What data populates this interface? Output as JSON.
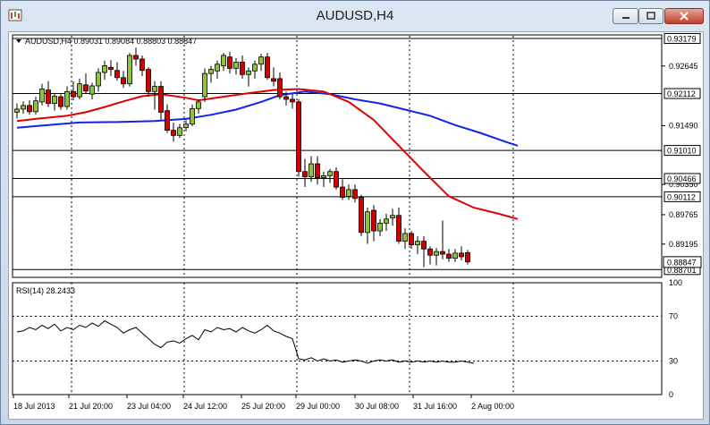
{
  "window": {
    "title": "AUDUSD,H4"
  },
  "chart_data": {
    "type": "candlestick",
    "symbol_info": "AUDUSD,H4  0.89031 0.89084 0.88803 0.88847",
    "ylim": [
      0.8855,
      0.933
    ],
    "price_ticks": [
      "0.92645",
      "0.91490",
      "0.90350",
      "0.89765",
      "0.89195"
    ],
    "hlines": [
      {
        "value": 0.93179,
        "label": "0.93179"
      },
      {
        "value": 0.92112,
        "label": "0.92112"
      },
      {
        "value": 0.9101,
        "label": "0.91010"
      },
      {
        "value": 0.90466,
        "label": "0.90466"
      },
      {
        "value": 0.90112,
        "label": "0.90112"
      },
      {
        "value": 0.88701,
        "label": "0.88701"
      }
    ],
    "current_price": {
      "value": 0.88847,
      "label": "0.88847"
    },
    "time_labels": [
      "18 Jul 2013",
      "21 Jul 20:00",
      "23 Jul 04:00",
      "24 Jul 12:00",
      "25 Jul 20:00",
      "29 Jul 00:00",
      "30 Jul 08:00",
      "31 Jul 16:00",
      "2 Aug 00:00"
    ],
    "candles": [
      [
        0.9175,
        0.9192,
        0.9163,
        0.9181
      ],
      [
        0.9181,
        0.9196,
        0.9172,
        0.9188
      ],
      [
        0.9188,
        0.9198,
        0.917,
        0.9176
      ],
      [
        0.9176,
        0.9205,
        0.917,
        0.9197
      ],
      [
        0.9195,
        0.923,
        0.9188,
        0.922
      ],
      [
        0.9218,
        0.9235,
        0.9185,
        0.9192
      ],
      [
        0.9192,
        0.9212,
        0.9178,
        0.9206
      ],
      [
        0.9205,
        0.921,
        0.918,
        0.9186
      ],
      [
        0.9186,
        0.9225,
        0.918,
        0.9215
      ],
      [
        0.9215,
        0.9235,
        0.9198,
        0.9205
      ],
      [
        0.9205,
        0.924,
        0.92,
        0.923
      ],
      [
        0.9228,
        0.925,
        0.921,
        0.9216
      ],
      [
        0.921,
        0.9232,
        0.92,
        0.9226
      ],
      [
        0.9226,
        0.926,
        0.9215,
        0.9252
      ],
      [
        0.9252,
        0.9275,
        0.9238,
        0.9265
      ],
      [
        0.9262,
        0.9276,
        0.9245,
        0.9258
      ],
      [
        0.9256,
        0.9272,
        0.9236,
        0.9242
      ],
      [
        0.9242,
        0.9255,
        0.9222,
        0.923
      ],
      [
        0.923,
        0.929,
        0.9225,
        0.9285
      ],
      [
        0.9285,
        0.93,
        0.9265,
        0.9278
      ],
      [
        0.9278,
        0.9285,
        0.9245,
        0.9256
      ],
      [
        0.9258,
        0.9262,
        0.9205,
        0.9215
      ],
      [
        0.9215,
        0.9235,
        0.918,
        0.9225
      ],
      [
        0.9225,
        0.9235,
        0.916,
        0.9175
      ],
      [
        0.9178,
        0.919,
        0.9135,
        0.914
      ],
      [
        0.914,
        0.9155,
        0.9118,
        0.913
      ],
      [
        0.913,
        0.9152,
        0.9125,
        0.9145
      ],
      [
        0.9145,
        0.916,
        0.9138,
        0.9152
      ],
      [
        0.9152,
        0.919,
        0.9148,
        0.9182
      ],
      [
        0.9182,
        0.92,
        0.9172,
        0.9195
      ],
      [
        0.9205,
        0.926,
        0.9195,
        0.925
      ],
      [
        0.925,
        0.9265,
        0.9232,
        0.9258
      ],
      [
        0.9255,
        0.9275,
        0.924,
        0.9268
      ],
      [
        0.9265,
        0.929,
        0.9255,
        0.9285
      ],
      [
        0.9282,
        0.9292,
        0.925,
        0.926
      ],
      [
        0.926,
        0.928,
        0.9248,
        0.9272
      ],
      [
        0.9272,
        0.9285,
        0.924,
        0.9248
      ],
      [
        0.9248,
        0.9262,
        0.9225,
        0.9255
      ],
      [
        0.9255,
        0.9275,
        0.924,
        0.9268
      ],
      [
        0.9268,
        0.9288,
        0.9255,
        0.9282
      ],
      [
        0.9282,
        0.929,
        0.9238,
        0.9242
      ],
      [
        0.924,
        0.9262,
        0.9225,
        0.9235
      ],
      [
        0.924,
        0.9252,
        0.92,
        0.9205
      ],
      [
        0.9205,
        0.9215,
        0.9188,
        0.92
      ],
      [
        0.92,
        0.921,
        0.9182,
        0.9195
      ],
      [
        0.9195,
        0.92,
        0.905,
        0.906
      ],
      [
        0.906,
        0.9085,
        0.903,
        0.905
      ],
      [
        0.905,
        0.909,
        0.904,
        0.9075
      ],
      [
        0.9075,
        0.909,
        0.9035,
        0.9048
      ],
      [
        0.9048,
        0.906,
        0.903,
        0.9052
      ],
      [
        0.9052,
        0.9065,
        0.9038,
        0.906
      ],
      [
        0.906,
        0.9068,
        0.9025,
        0.903
      ],
      [
        0.903,
        0.9045,
        0.9005,
        0.901
      ],
      [
        0.9012,
        0.9035,
        0.9005,
        0.9025
      ],
      [
        0.9025,
        0.9035,
        0.9,
        0.9008
      ],
      [
        0.901,
        0.9015,
        0.8935,
        0.8942
      ],
      [
        0.8942,
        0.899,
        0.892,
        0.8982
      ],
      [
        0.8985,
        0.8995,
        0.8925,
        0.8945
      ],
      [
        0.8945,
        0.8968,
        0.8935,
        0.896
      ],
      [
        0.896,
        0.8978,
        0.8945,
        0.8968
      ],
      [
        0.897,
        0.8988,
        0.8955,
        0.8975
      ],
      [
        0.8975,
        0.899,
        0.892,
        0.8925
      ],
      [
        0.8925,
        0.895,
        0.891,
        0.894
      ],
      [
        0.894,
        0.8945,
        0.891,
        0.8918
      ],
      [
        0.8918,
        0.8935,
        0.89,
        0.8925
      ],
      [
        0.8925,
        0.8935,
        0.8875,
        0.891
      ],
      [
        0.891,
        0.8915,
        0.888,
        0.8898
      ],
      [
        0.8898,
        0.8912,
        0.8878,
        0.8905
      ],
      [
        0.8905,
        0.8965,
        0.889,
        0.89
      ],
      [
        0.89,
        0.891,
        0.8885,
        0.8892
      ],
      [
        0.8892,
        0.891,
        0.8885,
        0.8902
      ],
      [
        0.8902,
        0.8915,
        0.8888,
        0.8895
      ],
      [
        0.8903,
        0.8908,
        0.888,
        0.8885
      ]
    ],
    "ma_red": [
      [
        0,
        0.9158
      ],
      [
        3,
        0.9162
      ],
      [
        8,
        0.9168
      ],
      [
        11,
        0.9175
      ],
      [
        14,
        0.9185
      ],
      [
        17,
        0.9196
      ],
      [
        20,
        0.9206
      ],
      [
        23,
        0.921
      ],
      [
        27,
        0.9203
      ],
      [
        29,
        0.9198
      ],
      [
        33,
        0.9205
      ],
      [
        37,
        0.9212
      ],
      [
        41,
        0.9218
      ],
      [
        45,
        0.922
      ],
      [
        49,
        0.9215
      ],
      [
        53,
        0.9195
      ],
      [
        57,
        0.916
      ],
      [
        61,
        0.911
      ],
      [
        65,
        0.906
      ],
      [
        69,
        0.9012
      ],
      [
        73,
        0.899
      ],
      [
        77,
        0.8978
      ],
      [
        80,
        0.8968
      ]
    ],
    "ma_blue": [
      [
        0,
        0.9145
      ],
      [
        5,
        0.915
      ],
      [
        10,
        0.9155
      ],
      [
        16,
        0.9156
      ],
      [
        22,
        0.9158
      ],
      [
        27,
        0.9162
      ],
      [
        31,
        0.917
      ],
      [
        35,
        0.918
      ],
      [
        39,
        0.9195
      ],
      [
        42,
        0.9208
      ],
      [
        46,
        0.9215
      ],
      [
        50,
        0.921
      ],
      [
        54,
        0.92
      ],
      [
        58,
        0.9192
      ],
      [
        62,
        0.918
      ],
      [
        66,
        0.9168
      ],
      [
        70,
        0.915
      ],
      [
        74,
        0.9135
      ],
      [
        78,
        0.9118
      ],
      [
        80,
        0.911
      ]
    ],
    "rsi": {
      "label": "RSI(14) 28.2433",
      "ylim": [
        0,
        100
      ],
      "levels": [
        70,
        30
      ],
      "ticks": [
        "100",
        "70",
        "30",
        "0"
      ],
      "values": [
        56,
        57,
        60,
        58,
        62,
        59,
        63,
        57,
        60,
        58,
        62,
        60,
        64,
        61,
        66,
        63,
        60,
        55,
        58,
        60,
        55,
        50,
        45,
        42,
        47,
        48,
        46,
        50,
        53,
        49,
        58,
        56,
        60,
        58,
        59,
        56,
        60,
        57,
        55,
        58,
        62,
        57,
        55,
        52,
        50,
        32,
        31,
        33,
        30,
        32,
        30,
        31,
        29,
        30,
        31,
        30,
        28,
        30,
        31,
        30,
        31,
        29,
        30,
        29,
        30,
        29,
        30,
        29,
        30,
        29,
        29,
        30,
        29,
        28
      ]
    },
    "colors": {
      "bull": "#8fc33a",
      "bear": "#d40000",
      "ma_fast": "#e00000",
      "ma_slow": "#1024ee"
    }
  }
}
